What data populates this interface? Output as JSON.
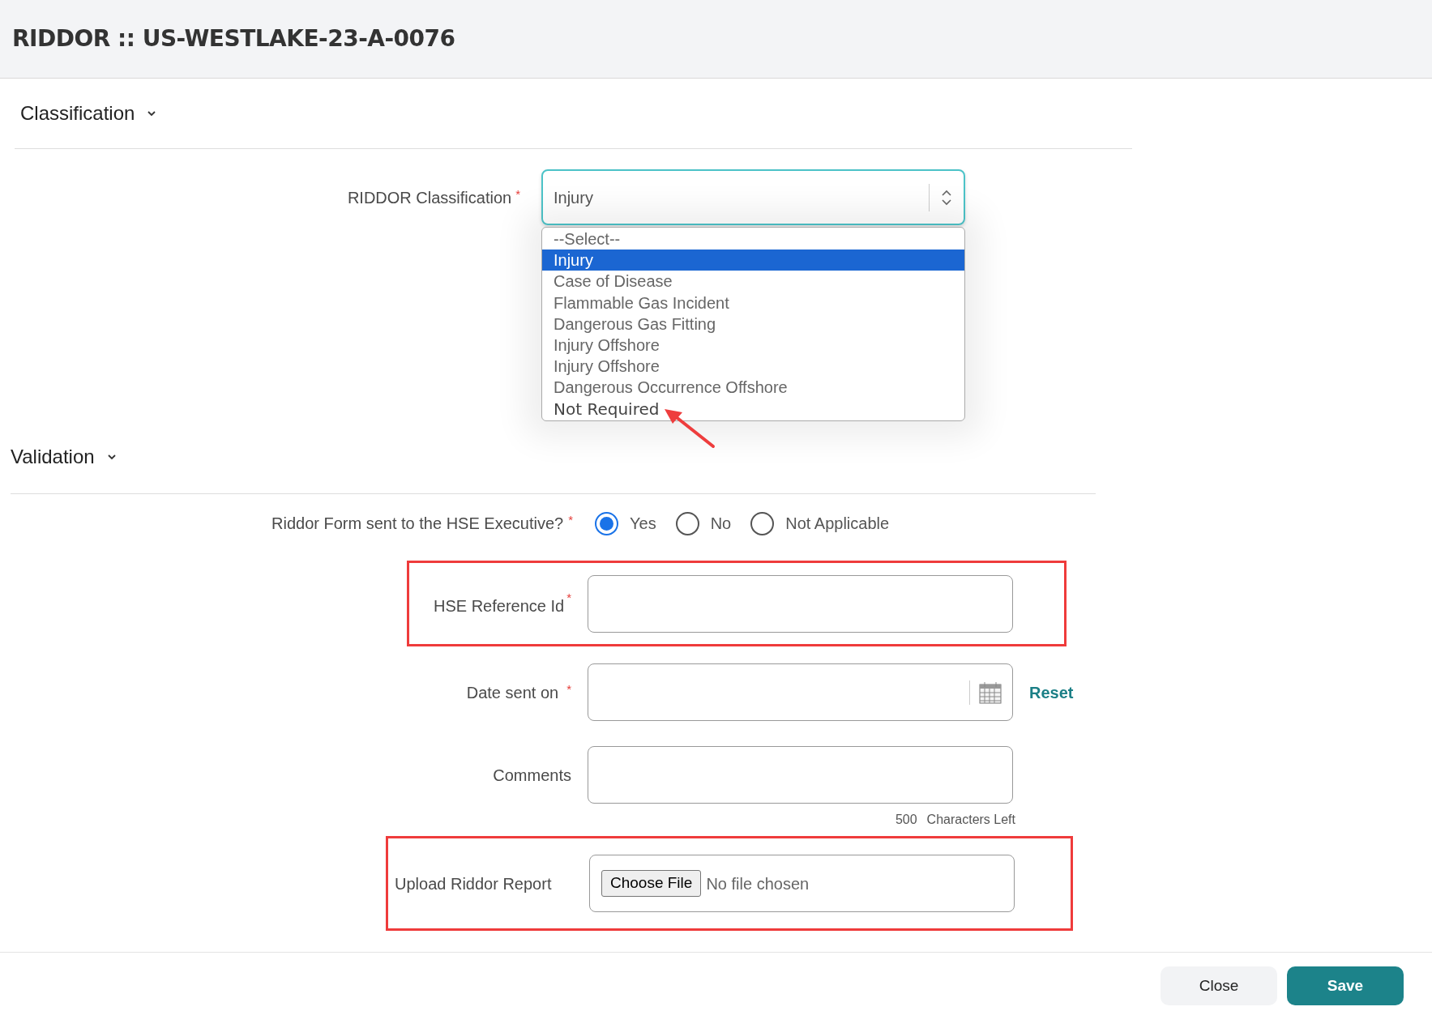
{
  "window": {
    "title": "RIDDOR :: US-WESTLAKE-23-A-0076"
  },
  "classification_section": {
    "title": "Classification"
  },
  "riddor_classification": {
    "label": "RIDDOR Classification",
    "required_mark": "*",
    "value": "Injury",
    "options": [
      {
        "label": "--Select--",
        "selected": false,
        "kind": "option"
      },
      {
        "label": "Injury",
        "selected": true,
        "kind": "option"
      },
      {
        "label": "Case of Disease",
        "selected": false,
        "kind": "option"
      },
      {
        "label": "Flammable Gas Incident",
        "selected": false,
        "kind": "option"
      },
      {
        "label": "Dangerous Gas Fitting",
        "selected": false,
        "kind": "option"
      },
      {
        "label": "Injury Offshore",
        "selected": false,
        "kind": "option"
      },
      {
        "label": "Injury Offshore",
        "selected": false,
        "kind": "option"
      },
      {
        "label": "Dangerous Occurrence Offshore",
        "selected": false,
        "kind": "option"
      },
      {
        "label": "Not Required",
        "selected": false,
        "kind": "annotated"
      }
    ]
  },
  "validation_section": {
    "title": "Validation"
  },
  "hse_form_sent": {
    "label": "Riddor Form sent to the HSE Executive?",
    "required_mark": "*",
    "options": [
      {
        "label": "Yes",
        "selected": true
      },
      {
        "label": "No",
        "selected": false
      },
      {
        "label": "Not Applicable",
        "selected": false
      }
    ]
  },
  "hse_reference_id": {
    "label": "HSE Reference Id",
    "required_mark": "*",
    "highlighted": true
  },
  "date_sent_on": {
    "label": "Date sent on",
    "required_mark": "*",
    "reset": "Reset"
  },
  "comments": {
    "label": "Comments",
    "counter": "500",
    "counter_label": "Characters Left"
  },
  "upload": {
    "label": "Upload Riddor Report",
    "button": "Choose File",
    "status": "No file chosen",
    "highlighted": true
  },
  "buttons": [
    {
      "label": "Close",
      "kind": "secondary"
    },
    {
      "label": "Save",
      "kind": "primary"
    }
  ]
}
